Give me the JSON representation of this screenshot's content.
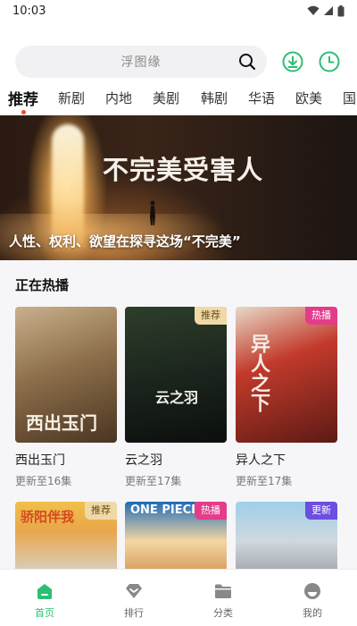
{
  "status_bar": {
    "time": "10:03"
  },
  "search": {
    "placeholder": "浮图缘"
  },
  "tabs": [
    {
      "label": "推荐",
      "active": true
    },
    {
      "label": "新剧"
    },
    {
      "label": "内地"
    },
    {
      "label": "美剧"
    },
    {
      "label": "韩剧"
    },
    {
      "label": "华语"
    },
    {
      "label": "欧美"
    },
    {
      "label": "国"
    }
  ],
  "banner": {
    "poster_title": "不完美受害人",
    "caption": "人性、权利、欲望在探寻这场“不完美”"
  },
  "section": {
    "title": "正在热播"
  },
  "cards": [
    {
      "title": "西出玉门",
      "subtitle": "更新至16集",
      "tag": "",
      "poster_text": "西出玉门"
    },
    {
      "title": "云之羽",
      "subtitle": "更新至17集",
      "tag": "推荐",
      "poster_text": "云之羽"
    },
    {
      "title": "异人之下",
      "subtitle": "更新至17集",
      "tag": "热播",
      "poster_text": "异人之下"
    },
    {
      "title": "",
      "subtitle": "",
      "tag": "推荐",
      "poster_text": "骄阳伴我"
    },
    {
      "title": "",
      "subtitle": "",
      "tag": "热播",
      "poster_text": "ONE PIECE"
    },
    {
      "title": "",
      "subtitle": "",
      "tag": "更新",
      "poster_text": ""
    }
  ],
  "bottom_nav": [
    {
      "label": "首页",
      "icon": "home-icon",
      "active": true
    },
    {
      "label": "排行",
      "icon": "ranking-icon"
    },
    {
      "label": "分类",
      "icon": "category-folder-icon"
    },
    {
      "label": "我的",
      "icon": "profile-icon"
    }
  ],
  "colors": {
    "accent": "#2bbf73",
    "hot_tag": "#e23c8a",
    "new_tag": "#6c4ee0",
    "recommend_tag": "#efd9a9",
    "active_tab_dot": "#f04a2e"
  }
}
